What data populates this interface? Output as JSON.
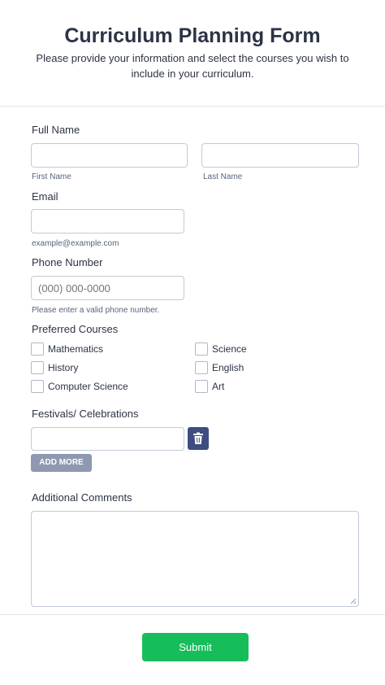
{
  "header": {
    "title": "Curriculum Planning Form",
    "subtitle": "Please provide your information and select the courses you wish to include in your curriculum."
  },
  "full_name": {
    "label": "Full Name",
    "first_value": "",
    "last_value": "",
    "first_sublabel": "First Name",
    "last_sublabel": "Last Name"
  },
  "email": {
    "label": "Email",
    "value": "",
    "sublabel": "example@example.com"
  },
  "phone": {
    "label": "Phone Number",
    "placeholder": "(000) 000-0000",
    "sublabel": "Please enter a valid phone number."
  },
  "courses": {
    "label": "Preferred Courses",
    "options": [
      "Mathematics",
      "Science",
      "History",
      "English",
      "Computer Science",
      "Art"
    ]
  },
  "festivals": {
    "label": "Festivals/ Celebrations",
    "value": "",
    "add_more_label": "ADD MORE"
  },
  "comments": {
    "label": "Additional Comments",
    "value": ""
  },
  "submit_label": "Submit",
  "colors": {
    "submit": "#18bd5b",
    "trash_button": "#3e4c7f",
    "add_more_button": "#8e98b0",
    "text": "#2c3345"
  }
}
